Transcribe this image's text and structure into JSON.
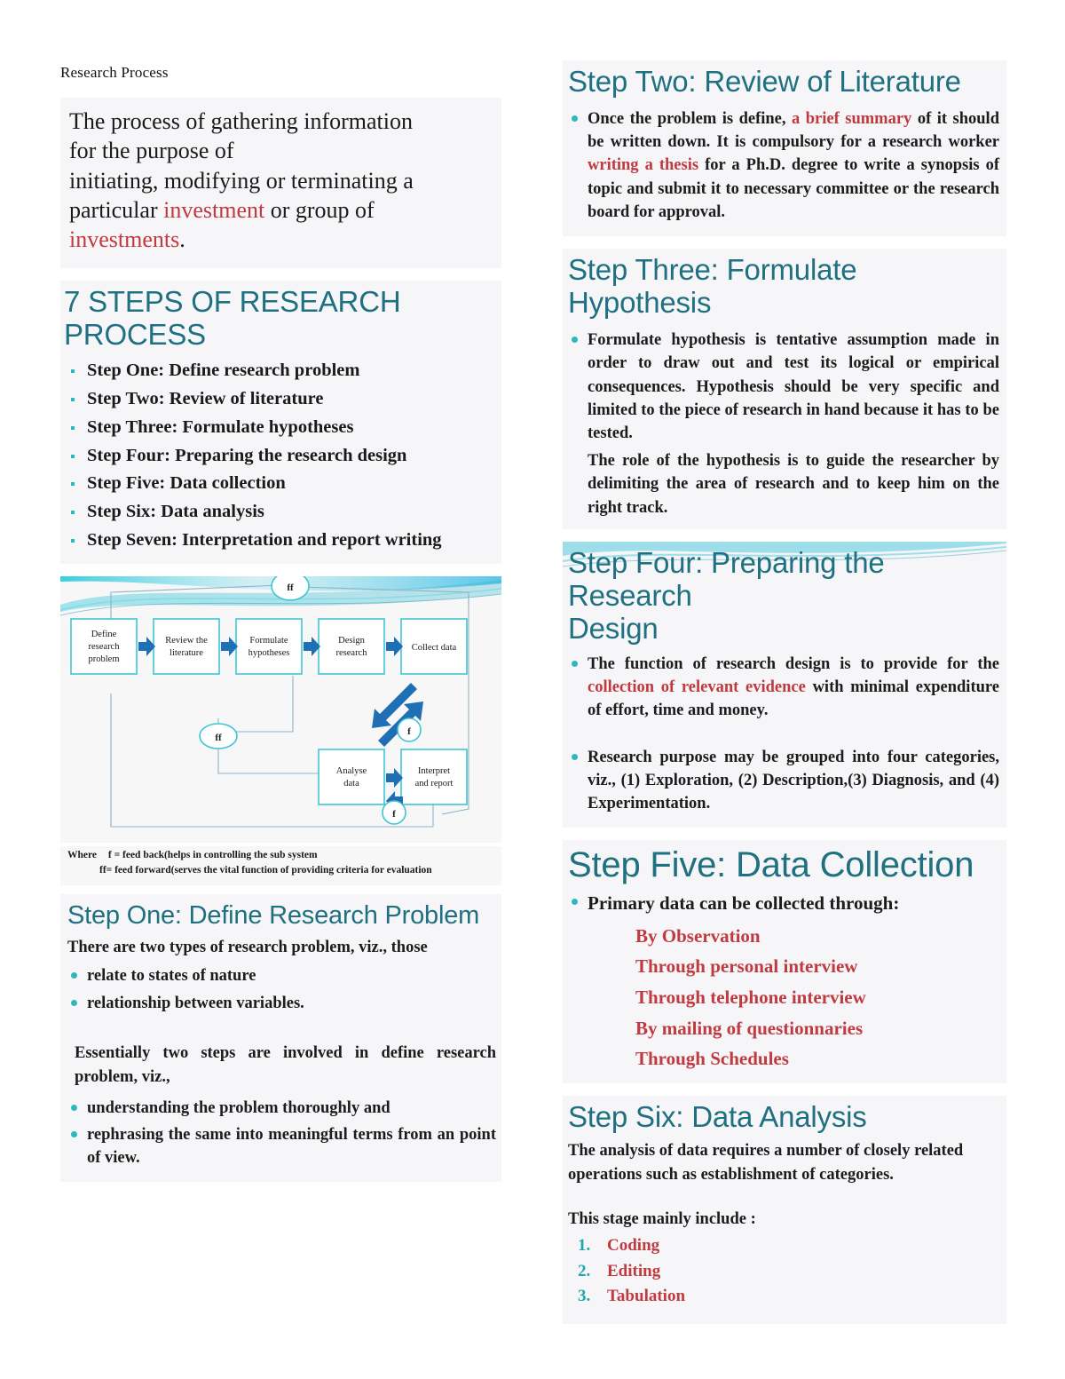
{
  "colors": {
    "heading_teal": "#1f7080",
    "bullet_teal": "#2eb8bd",
    "red": "#c0393f",
    "slide_bg": "#f6f5f7",
    "arrow_blue": "#1f6fb5",
    "box_border": "#3fc5d6"
  },
  "doc_title": "Research Process",
  "left": {
    "intro": {
      "line1": "The process of gathering information",
      "line2": "for the purpose of",
      "line3": "initiating, modifying or terminating a",
      "line4_a": "particular ",
      "line4_red": "investment",
      "line4_b": " or group of",
      "line5_red": "investments",
      "line5_b": "."
    },
    "steps_heading": "7 STEPS OF RESEARCH PROCESS",
    "steps": [
      "Step One: Define research problem",
      "Step Two: Review of literature",
      "Step Three: Formulate hypotheses",
      "Step Four: Preparing the research design",
      "Step Five: Data collection",
      "Step Six: Data analysis",
      "Step Seven: Interpretation and report writing"
    ],
    "flowchart": {
      "boxes": [
        "Define research problem",
        "Review the literature",
        "Formulate hypotheses",
        "Design research",
        "Collect data",
        "Analyse data",
        "Interpret and report"
      ],
      "node_labels": [
        "ff",
        "ff",
        "f",
        "f"
      ],
      "legend_line1_lead": "Where",
      "legend_line1": "f = feed back(helps in controlling the sub system",
      "legend_line2": "ff= feed forward(serves the vital function of providing criteria for evaluation"
    },
    "step_one": {
      "heading": "Step One: Define Research Problem",
      "intro": "There  are two types of research problem, viz., those",
      "bullets": [
        "relate to states of nature",
        "relationship between variables."
      ],
      "para": "Essentially  two  steps  are  involved  in  define  research problem, viz.,",
      "bullets2": [
        "understanding the problem thoroughly and",
        "rephrasing  the  same  into  meaningful  terms  from  an point of view."
      ]
    }
  },
  "right": {
    "step_two": {
      "heading": "Step Two: Review of Literature",
      "body_a": "Once  the  problem  is  define, ",
      "body_red1": "a  brief  summary",
      "body_b": "  of  it should   be   written   down.   It   is   compulsory   for   a research  worker ",
      "body_red2": "writing a thesis",
      "body_c": " for a Ph.D. degree to write  a  synopsis  of  topic  and  submit  it  to  necessary committee or the research  board for approval."
    },
    "step_three": {
      "heading": "Step Three: Formulate Hypothesis",
      "body": "Formulate hypothesis is tentative assumption made in order  to  draw  out  and  test  its  logical  or  empirical consequences. Hypothesis  should be very specific and limited to the piece of research in hand because it has to be tested.",
      "red": "The role of the hypothesis is to guide the researcher by delimiting the area of research and to keep him on the right track."
    },
    "step_four": {
      "heading_line1": "Step Four: Preparing the Research",
      "heading_line2": "Design",
      "b1_a": " The  function  of  research  design  is  to  provide   for  the ",
      "b1_red": "collection   of   relevant   evidence",
      "b1_b": "  with   minimal expenditure of effort, time and money.",
      "b2": "Research   purpose   may   be   grouped   into   four categories,  viz.,  (1)  Exploration,  (2)  Description,(3) Diagnosis, and (4) Experimentation."
    },
    "step_five": {
      "heading": "Step Five: Data Collection",
      "bullet": "Primary data can be collected through:",
      "methods": [
        "By Observation",
        "Through personal interview",
        "Through telephone interview",
        "By mailing of questionnaries",
        "Through Schedules"
      ]
    },
    "step_six": {
      "heading": "Step Six: Data Analysis",
      "para": "The analysis of data requires a number of closely related operations such as establishment of categories.",
      "intro2": "This stage mainly include :",
      "items": [
        "Coding",
        "Editing",
        "Tabulation"
      ]
    }
  }
}
